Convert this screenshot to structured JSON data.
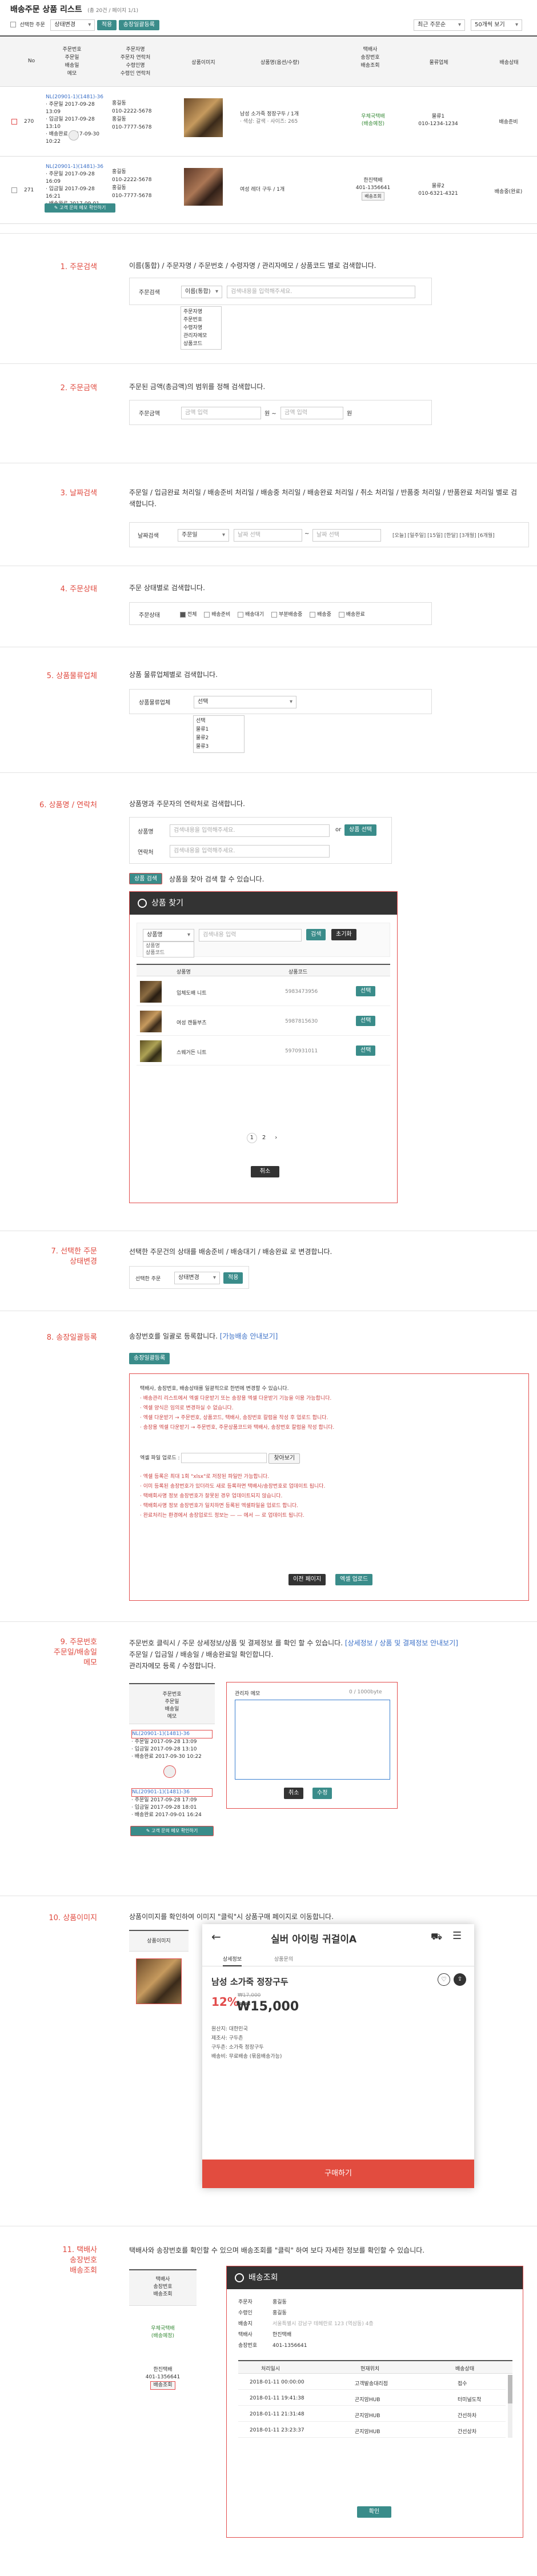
{
  "header": {
    "title": "배송주문 상품 리스트",
    "count": "(총 20건 / 페이지 1/1)"
  },
  "toolbar": {
    "select_all": "선택한 주문",
    "state_select": "상태변경",
    "apply": "적용",
    "excel": "송장일괄등록",
    "sort": "최근 주문순",
    "per_page": "50개씩 보기"
  },
  "table": {
    "headers": [
      "No",
      "주문번호\n주문일\n배송일\n메모",
      "주문자명\n주문자 연락처\n수령인명\n수령인 연락처",
      "상품이미지",
      "상품명(옵션/수량)",
      "택배사\n송장번호\n배송조회",
      "물류업체",
      "배송상태"
    ],
    "rows": [
      {
        "no": "270",
        "order_no": "NL(20901-1)(1481)-36",
        "date1": "· 주문일 2017-09-28 13:09",
        "date2": "· 입금일 2017-09-28 13:10",
        "date3": "· 배송완료 2017-09-30 10:22",
        "orderer": "홍길동",
        "phone1": "010-2222-5678",
        "receiver": "홍길동",
        "phone2": "010-7777-5678",
        "product": "남성 소가죽 정장구두 / 1개",
        "option": "· 색상: 갈색 · 사이즈: 265",
        "courier": "우체국택배",
        "track": "(배송예정)",
        "logistics": "물류1",
        "logi_phone": "010-1234-1234",
        "status": "배송준비"
      },
      {
        "no": "271",
        "order_no": "NL(20901-1)(1481)-36",
        "date1": "· 주문일 2017-09-28 16:09",
        "date2": "· 입금일 2017-09-28 16:21",
        "date3": "· 배송완료 2017-09-01 16:24",
        "orderer": "홍길동",
        "phone1": "010-2222-5678",
        "receiver": "홍길동",
        "phone2": "010-7777-5678",
        "product": "여성 레더 구두 / 1개",
        "option": "",
        "courier": "한진택배",
        "track": "401-1356641",
        "track2": "배송조회",
        "logistics": "물류2",
        "logi_phone": "010-6321-4321",
        "status": "배송중(완료)"
      }
    ],
    "memo_button": "고객 문의 메모 확인하기"
  },
  "sections": [
    {
      "num": "1. 주문검색",
      "desc": "이름(통합) / 주문자명 / 주문번호 / 수령자명 / 관리자메모 / 상품코드 별로 검색합니다.",
      "label": "주문검색",
      "select": "이름(통합)",
      "placeholder": "검색내용을 입력해주세요.",
      "options": [
        "주문자명",
        "주문번호",
        "수령자명",
        "관리자메모",
        "상품코드"
      ]
    },
    {
      "num": "2. 주문금액",
      "desc": "주문된 금액(총금액)의 범위를 정해 검색합니다.",
      "label": "주문금액",
      "from": "금액 입력",
      "sep": "원 ~",
      "to": "금액 입력",
      "unit": "원"
    },
    {
      "num": "3. 날짜검색",
      "desc": "주문일 / 입금완료 처리일 / 배송준비 처리일 / 배송중 처리일 / 배송완료 처리일 / 취소 처리일 / 반품중 처리일 / 반품완료 처리일 별로 검색합니다.",
      "label": "날짜검색",
      "select": "주문일",
      "from": "날짜 선택",
      "sep": "~",
      "to": "날짜 선택",
      "quick": "[오늘] [일주일] [15일] [한달] [3개월] [6개월]"
    },
    {
      "num": "4. 주문상태",
      "desc": "주문 상태별로 검색합니다.",
      "label": "주문상태",
      "options": [
        "전체",
        "배송준비",
        "배송대기",
        "부분배송중",
        "배송중",
        "배송완료"
      ]
    },
    {
      "num": "5. 상품물류업체",
      "desc": "상품 물류업체별로 검색합니다.",
      "label": "상품물류업체",
      "select": "선택",
      "options": [
        "선택",
        "물류1",
        "물류2",
        "물류3"
      ]
    },
    {
      "num": "6. 상품명 / 연락처",
      "desc": "상품명과 주문자의 연락처로 검색합니다.",
      "label1": "상품명",
      "ph1": "검색내용을 입력해주세요.",
      "or": "or",
      "btn": "상품 선택",
      "label2": "연락처",
      "ph2": "검색내용을 입력해주세요.",
      "tag": "상품 검색",
      "tag_desc": "상품을 찾아 검색 할 수 있습니다."
    },
    {
      "num": "7. 선택한 주문\n상태변경",
      "desc": "선택한 주문건의 상태를 배송준비 / 배송대기 / 배송완료 로 변경합니다.",
      "select1": "선택한 주문",
      "select2": "상태변경",
      "apply": "적용"
    },
    {
      "num": "8. 송장일괄등록",
      "desc": "송장번호를 일괄로 등록합니다.",
      "link": "[가능배송 안내보기]",
      "btn": "송장일괄등록"
    },
    {
      "num": "9. 주문번호\n주문일/배송일\n메모",
      "desc": "주문번호 클릭시 / 주문 상세정보/상품 및 결제정보 를 확인 할 수 있습니다.",
      "link": "[상세정보 / 상품 및 결제정보 안내보기]",
      "desc2": "주문일 / 입금일 / 배송일 / 배송완료일 확인합니다.",
      "desc3": "관리자메모 등록 / 수정합니다."
    },
    {
      "num": "10. 상품이미지",
      "desc": "상품이미지를 확인하여 이미지 \"클릭\"시 상품구매 페이지로 이동합니다."
    },
    {
      "num": "11. 택배사\n송장번호\n배송조회",
      "desc": "택배사와 송장번호를 확인할 수 있으며 배송조회를 \"클릭\" 하여 보다 자세한 정보를 확인할 수 있습니다."
    }
  ],
  "product_modal": {
    "title": "상품 찾기",
    "select": "상품명",
    "options": [
      "상품명",
      "상품코드"
    ],
    "placeholder": "검색내용 입력",
    "search": "검색",
    "reset": "초기화",
    "headers": [
      "상품명",
      "상품코드",
      ""
    ],
    "items": [
      {
        "name": "입체도배 니트",
        "code": "5983473956",
        "btn": "선택"
      },
      {
        "name": "여성 캔들부츠",
        "code": "5987815630",
        "btn": "선택"
      },
      {
        "name": "스웨거든 니트",
        "code": "5970931011",
        "btn": "선택"
      }
    ],
    "pages": [
      "1",
      "2",
      "›"
    ],
    "close": "취소"
  },
  "excel_box": {
    "notes_title": "택배사, 송장번호, 배송상태를 일괄적으로 한번에 변경할 수 있습니다.",
    "notes": [
      "· 배송관리 리스트에서 엑셀 다운받기 또는 송장용 엑셀 다운받기 기능을 이용 가능합니다.",
      "· 엑셀 양식은 임의로 변경하실 수 없습니다.",
      "· 엑셀 다운받기 → 주문번호, 상품코드, 택배사, 송장번호 칼럼을 작성 후 업로드 합니다.",
      "· 송장용 엑셀 다운받기 → 주문번호, 주문상품코드와 택배사, 송장번호 칼럼을 작성 합니다."
    ],
    "file_label": "엑셀 파일 업로드 :",
    "file_btn": "찾아보기",
    "notes2": [
      "· 엑셀 등록은 최대 1회 \"xlsx\"로 저장된 파일만 가능합니다.",
      "· 이미 등록된 송장번호가 있더라도 새로 등록하면 택배사/송장번호로 업데이트 됩니다.",
      "· 택배회사명 정보 송장번호가 잘못된 경우 업데이트되지 않습니다.",
      "· 택배회사명 정보 송장번호가 일치하면 등록된 엑셀파일을 업로드 합니다.",
      "· 완료처리는 환경에서 송장업로드 정보는 — — 에서 — 로 업데이트 됩니다."
    ],
    "btn1": "이전 페이지",
    "btn2": "엑셀 업로드"
  },
  "memo": {
    "headers": "주문번호\n주문일\n배송일\n메모",
    "order_no": "NL(20901-1)(1481)-36",
    "d1": "· 주문일 2017-09-28 13:09",
    "d2": "· 입금일 2017-09-28 13:10",
    "d3": "· 배송완료 2017-09-30 10:22",
    "order_no2": "NL(20901-1)(1481)-36",
    "d4": "· 주문일 2017-09-28 17:09",
    "d5": "· 입금일 2017-09-28 18:01",
    "d6": "· 배송완료 2017-09-01 16:24",
    "memo_btn": "고객 문의 메모 확인하기",
    "popup_title": "관리자 메모",
    "counter": "0 / 1000byte",
    "cancel": "취소",
    "save": "수정"
  },
  "mobile": {
    "img_header": "상품이미지",
    "title": "실버 아이링 귀걸이A",
    "tabs": [
      "상세정보",
      "상품문의"
    ],
    "product": "남성 소가죽 정장구두",
    "discount": "12%",
    "old_price": "₩17,000",
    "price": "₩15,000",
    "info": [
      "원산지: 대한민국",
      "제조사: 구두촌",
      "구두촌: 소가죽 정장구두",
      "배송비: 무료배송 (묶음배송가능)"
    ],
    "buy": "구매하기"
  },
  "delivery_modal": {
    "header": "택배사\n송장번호\n배송조회",
    "courier": "우체국택배",
    "track": "(배송예정)",
    "courier2": "한진택배",
    "track2": "401-1356641",
    "lookup": "배송조회",
    "title": "배송조회",
    "info_labels": [
      "주문자",
      "수령인",
      "배송지",
      "택배사",
      "송장번호"
    ],
    "info_values": [
      "홍길동",
      "홍길동",
      "서울특별시 강남구 테헤란로 123 (역삼동) 4층",
      "한진택배",
      "401-1356641"
    ],
    "headers": [
      "처리일시",
      "현재위치",
      "배송상태"
    ],
    "rows": [
      [
        "2018-01-11 00:00:00",
        "고객발송대리점",
        "접수"
      ],
      [
        "2018-01-11 19:41:38",
        "곤지암HUB",
        "터미널도착"
      ],
      [
        "2018-01-11 21:31:48",
        "곤지암HUB",
        "간선하차"
      ],
      [
        "2018-01-11 23:23:37",
        "곤지암HUB",
        "간선상차"
      ]
    ],
    "confirm": "확인"
  }
}
